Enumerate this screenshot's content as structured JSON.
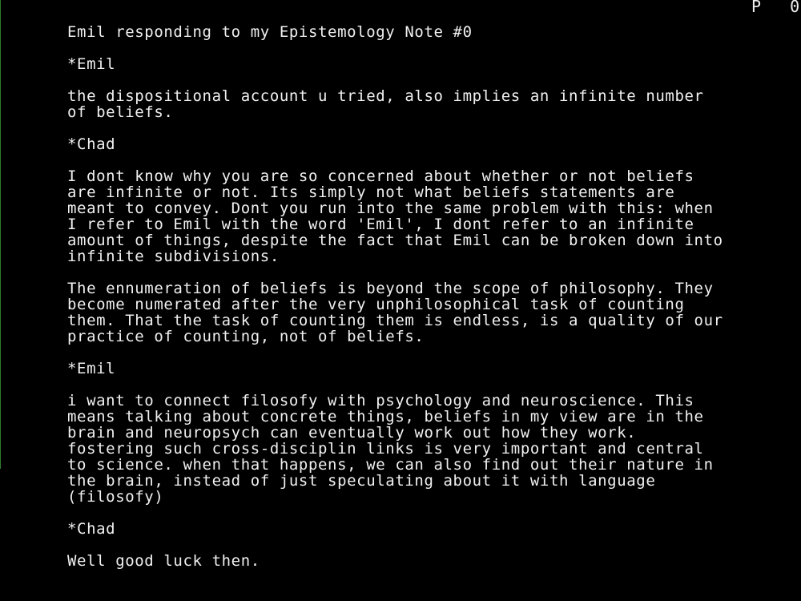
{
  "status": {
    "page_label": "P",
    "page_number": "0"
  },
  "document": {
    "title": "Emil responding to my Epistemology Note #0",
    "sections": [
      {
        "speaker": "*Emil"
      },
      {
        "lines": [
          "the dispositional account u tried, also implies an infinite number",
          "of beliefs."
        ]
      },
      {
        "speaker": "*Chad"
      },
      {
        "lines": [
          "I dont know why you are so concerned about whether or not beliefs",
          "are infinite or not. Its simply not what beliefs statements are",
          "meant to convey. Dont you run into the same problem with this: when",
          "I refer to Emil with the word 'Emil', I dont refer to an infinite",
          "amount of things, despite the fact that Emil can be broken down into",
          "infinite subdivisions."
        ]
      },
      {
        "lines": [
          "The ennumeration of beliefs is beyond the scope of philosophy. They",
          "become numerated after the very unphilosophical task of counting",
          "them. That the task of counting them is endless, is a quality of our",
          "practice of counting, not of beliefs."
        ]
      },
      {
        "speaker": "*Emil"
      },
      {
        "lines": [
          "i want to connect filosofy with psychology and neuroscience. This",
          "means talking about concrete things, beliefs in my view are in the",
          "brain and neuropsych can eventually work out how they work.",
          "fostering such cross-disciplin links is very important and central",
          "to science. when that happens, we can also find out their nature in",
          "the brain, instead of just speculating about it with language",
          "(filosofy)"
        ]
      },
      {
        "speaker": "*Chad"
      },
      {
        "lines": [
          "Well good luck then."
        ]
      }
    ]
  }
}
